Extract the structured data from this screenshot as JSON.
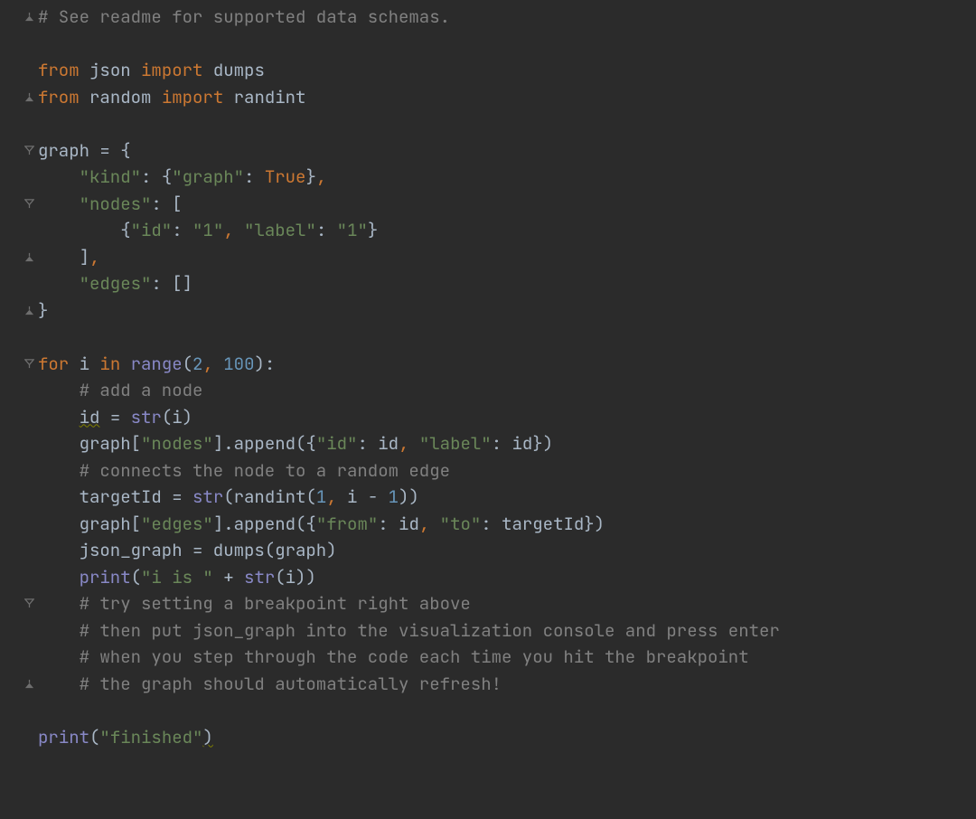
{
  "code": {
    "lines": [
      {
        "fold": "close",
        "tokens": [
          {
            "cls": "tk-comment",
            "t": "# See readme for supported data schemas."
          }
        ]
      },
      {
        "fold": "",
        "tokens": []
      },
      {
        "fold": "",
        "tokens": [
          {
            "cls": "tk-keyword",
            "t": "from "
          },
          {
            "cls": "tk-default",
            "t": "json "
          },
          {
            "cls": "tk-keyword",
            "t": "import "
          },
          {
            "cls": "tk-default",
            "t": "dumps"
          }
        ]
      },
      {
        "fold": "close",
        "tokens": [
          {
            "cls": "tk-keyword",
            "t": "from "
          },
          {
            "cls": "tk-default",
            "t": "random "
          },
          {
            "cls": "tk-keyword",
            "t": "import "
          },
          {
            "cls": "tk-default",
            "t": "randint"
          }
        ]
      },
      {
        "fold": "",
        "tokens": []
      },
      {
        "fold": "open",
        "tokens": [
          {
            "cls": "tk-default",
            "t": "graph = {"
          }
        ]
      },
      {
        "fold": "",
        "tokens": [
          {
            "cls": "tk-default",
            "t": "    "
          },
          {
            "cls": "tk-string",
            "t": "\"kind\""
          },
          {
            "cls": "tk-default",
            "t": ": {"
          },
          {
            "cls": "tk-string",
            "t": "\"graph\""
          },
          {
            "cls": "tk-default",
            "t": ": "
          },
          {
            "cls": "tk-const",
            "t": "True"
          },
          {
            "cls": "tk-default",
            "t": "}"
          },
          {
            "cls": "tk-keyword",
            "t": ","
          }
        ]
      },
      {
        "fold": "open",
        "tokens": [
          {
            "cls": "tk-default",
            "t": "    "
          },
          {
            "cls": "tk-string",
            "t": "\"nodes\""
          },
          {
            "cls": "tk-default",
            "t": ": ["
          }
        ]
      },
      {
        "fold": "",
        "tokens": [
          {
            "cls": "tk-default",
            "t": "        {"
          },
          {
            "cls": "tk-string",
            "t": "\"id\""
          },
          {
            "cls": "tk-default",
            "t": ": "
          },
          {
            "cls": "tk-string",
            "t": "\"1\""
          },
          {
            "cls": "tk-keyword",
            "t": ", "
          },
          {
            "cls": "tk-string",
            "t": "\"label\""
          },
          {
            "cls": "tk-default",
            "t": ": "
          },
          {
            "cls": "tk-string",
            "t": "\"1\""
          },
          {
            "cls": "tk-default",
            "t": "}"
          }
        ]
      },
      {
        "fold": "close",
        "tokens": [
          {
            "cls": "tk-default",
            "t": "    ]"
          },
          {
            "cls": "tk-keyword",
            "t": ","
          }
        ]
      },
      {
        "fold": "",
        "tokens": [
          {
            "cls": "tk-default",
            "t": "    "
          },
          {
            "cls": "tk-string",
            "t": "\"edges\""
          },
          {
            "cls": "tk-default",
            "t": ": []"
          }
        ]
      },
      {
        "fold": "close",
        "tokens": [
          {
            "cls": "tk-default",
            "t": "}"
          }
        ]
      },
      {
        "fold": "",
        "tokens": []
      },
      {
        "fold": "open",
        "tokens": [
          {
            "cls": "tk-keyword",
            "t": "for "
          },
          {
            "cls": "tk-default",
            "t": "i "
          },
          {
            "cls": "tk-keyword",
            "t": "in "
          },
          {
            "cls": "tk-builtin",
            "t": "range"
          },
          {
            "cls": "tk-default",
            "t": "("
          },
          {
            "cls": "tk-number",
            "t": "2"
          },
          {
            "cls": "tk-keyword",
            "t": ", "
          },
          {
            "cls": "tk-number",
            "t": "100"
          },
          {
            "cls": "tk-default",
            "t": "):"
          }
        ]
      },
      {
        "fold": "",
        "tokens": [
          {
            "cls": "tk-default",
            "t": "    "
          },
          {
            "cls": "tk-comment",
            "t": "# add a node"
          }
        ]
      },
      {
        "fold": "",
        "tokens": [
          {
            "cls": "tk-default",
            "t": "    "
          },
          {
            "cls": "tk-weak-default underline-olive",
            "t": "id"
          },
          {
            "cls": "tk-default",
            "t": " = "
          },
          {
            "cls": "tk-builtin",
            "t": "str"
          },
          {
            "cls": "tk-default",
            "t": "(i)"
          }
        ]
      },
      {
        "fold": "",
        "tokens": [
          {
            "cls": "tk-default",
            "t": "    graph["
          },
          {
            "cls": "tk-string",
            "t": "\"nodes\""
          },
          {
            "cls": "tk-default",
            "t": "].append({"
          },
          {
            "cls": "tk-string",
            "t": "\"id\""
          },
          {
            "cls": "tk-default",
            "t": ": id"
          },
          {
            "cls": "tk-keyword",
            "t": ", "
          },
          {
            "cls": "tk-string",
            "t": "\"label\""
          },
          {
            "cls": "tk-default",
            "t": ": id})"
          }
        ]
      },
      {
        "fold": "",
        "tokens": [
          {
            "cls": "tk-default",
            "t": "    "
          },
          {
            "cls": "tk-comment",
            "t": "# connects the node to a random edge"
          }
        ]
      },
      {
        "fold": "",
        "tokens": [
          {
            "cls": "tk-default",
            "t": "    targetId = "
          },
          {
            "cls": "tk-builtin",
            "t": "str"
          },
          {
            "cls": "tk-default",
            "t": "(randint("
          },
          {
            "cls": "tk-number",
            "t": "1"
          },
          {
            "cls": "tk-keyword",
            "t": ", "
          },
          {
            "cls": "tk-default",
            "t": "i - "
          },
          {
            "cls": "tk-number",
            "t": "1"
          },
          {
            "cls": "tk-default",
            "t": "))"
          }
        ]
      },
      {
        "fold": "",
        "tokens": [
          {
            "cls": "tk-default",
            "t": "    graph["
          },
          {
            "cls": "tk-string",
            "t": "\"edges\""
          },
          {
            "cls": "tk-default",
            "t": "].append({"
          },
          {
            "cls": "tk-string",
            "t": "\"from\""
          },
          {
            "cls": "tk-default",
            "t": ": id"
          },
          {
            "cls": "tk-keyword",
            "t": ", "
          },
          {
            "cls": "tk-string",
            "t": "\"to\""
          },
          {
            "cls": "tk-default",
            "t": ": targetId})"
          }
        ]
      },
      {
        "fold": "",
        "tokens": [
          {
            "cls": "tk-default",
            "t": "    json_graph = dumps(graph)"
          }
        ]
      },
      {
        "fold": "",
        "tokens": [
          {
            "cls": "tk-default",
            "t": "    "
          },
          {
            "cls": "tk-printfn",
            "t": "print"
          },
          {
            "cls": "tk-default",
            "t": "("
          },
          {
            "cls": "tk-string",
            "t": "\"i is \""
          },
          {
            "cls": "tk-default",
            "t": " + "
          },
          {
            "cls": "tk-builtin",
            "t": "str"
          },
          {
            "cls": "tk-default",
            "t": "(i))"
          }
        ]
      },
      {
        "fold": "open",
        "tokens": [
          {
            "cls": "tk-default",
            "t": "    "
          },
          {
            "cls": "tk-comment",
            "t": "# try setting a breakpoint right above"
          }
        ]
      },
      {
        "fold": "",
        "tokens": [
          {
            "cls": "tk-default",
            "t": "    "
          },
          {
            "cls": "tk-comment",
            "t": "# then put json_graph into the visualization console and press enter"
          }
        ]
      },
      {
        "fold": "",
        "tokens": [
          {
            "cls": "tk-default",
            "t": "    "
          },
          {
            "cls": "tk-comment",
            "t": "# when you step through the code each time you hit the breakpoint"
          }
        ]
      },
      {
        "fold": "close",
        "tokens": [
          {
            "cls": "tk-default",
            "t": "    "
          },
          {
            "cls": "tk-comment",
            "t": "# the graph should automatically refresh!"
          }
        ]
      },
      {
        "fold": "",
        "tokens": []
      },
      {
        "fold": "",
        "tokens": [
          {
            "cls": "tk-printfn",
            "t": "print"
          },
          {
            "cls": "tk-default",
            "t": "("
          },
          {
            "cls": "tk-string",
            "t": "\"finished\""
          },
          {
            "cls": "tk-default underline-olive",
            "t": ")"
          }
        ]
      }
    ]
  },
  "foldIcons": {
    "openLabel": "fold-open-icon",
    "closeLabel": "fold-close-icon"
  }
}
